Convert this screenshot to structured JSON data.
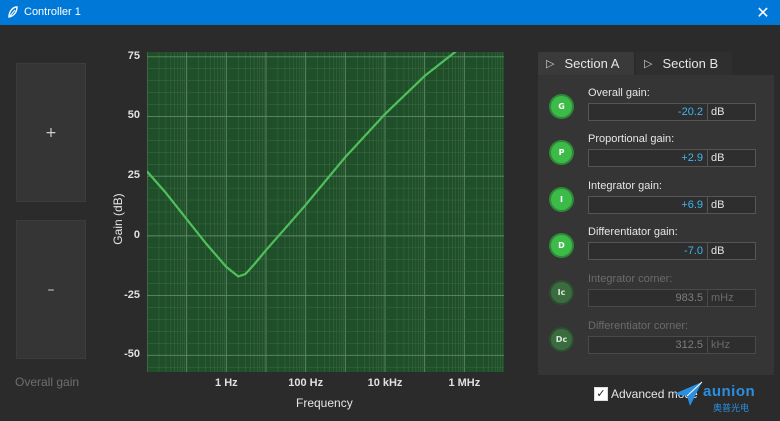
{
  "window": {
    "title": "Controller 1",
    "close_glyph": "✕"
  },
  "left": {
    "plus_label": "+",
    "minus_label": "–",
    "overall_gain_label": "Overall gain"
  },
  "chart_data": {
    "type": "line",
    "xlabel": "Frequency",
    "ylabel": "Gain (dB)",
    "xscale": "log",
    "xlim": [
      0.01,
      10000000
    ],
    "ylim": [
      -57,
      77
    ],
    "x_ticks": [
      1,
      100,
      10000,
      1000000
    ],
    "x_tick_labels": [
      "1 Hz",
      "100 Hz",
      "10 kHz",
      "1 MHz"
    ],
    "y_ticks": [
      75,
      50,
      25,
      0,
      -25,
      -50
    ],
    "y_tick_labels": [
      "75",
      "50",
      "25",
      "0",
      "-25",
      "-50"
    ],
    "grid": true,
    "series": [
      {
        "x": [
          0.01,
          0.03,
          0.1,
          0.3,
          1,
          2,
          3,
          5,
          10,
          30,
          100,
          1000,
          10000,
          100000,
          1000000,
          2000000
        ],
        "y": [
          27,
          18,
          7,
          -3,
          -13,
          -17,
          -16,
          -12,
          -6,
          3,
          13,
          33,
          51,
          67,
          80,
          84
        ]
      }
    ],
    "line_color": "#4fc05c"
  },
  "tabs": {
    "a_label": "Section A",
    "b_label": "Section B",
    "tri": "▷"
  },
  "params": [
    {
      "badge": "G",
      "label": "Overall gain:",
      "value": "-20.2",
      "unit": "dB",
      "enabled": true
    },
    {
      "badge": "P",
      "label": "Proportional gain:",
      "value": "+2.9",
      "unit": "dB",
      "enabled": true
    },
    {
      "badge": "I",
      "label": "Integrator gain:",
      "value": "+6.9",
      "unit": "dB",
      "enabled": true
    },
    {
      "badge": "D",
      "label": "Differentiator gain:",
      "value": "-7.0",
      "unit": "dB",
      "enabled": true
    },
    {
      "badge": "Ic",
      "label": "Integrator corner:",
      "value": "983.5",
      "unit": "mHz",
      "enabled": false
    },
    {
      "badge": "Dc",
      "label": "Differentiator corner:",
      "value": "312.5",
      "unit": "kHz",
      "enabled": false
    }
  ],
  "advanced": {
    "label": "Advanced mode",
    "checked": true,
    "check_glyph": "✓"
  },
  "watermark": {
    "text": "aunion",
    "sub": "奥普光电"
  },
  "colors": {
    "titlebar": "#0078d7",
    "accent": "#3fb6f0",
    "badge_on": "#3dbb48"
  }
}
